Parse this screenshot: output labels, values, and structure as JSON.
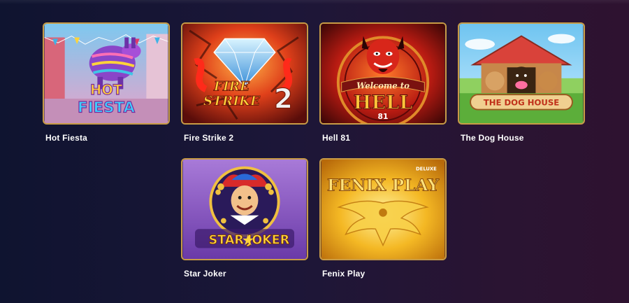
{
  "games": [
    {
      "title": "Hot Fiesta",
      "art_text": [
        "HOT",
        "FIESTA"
      ],
      "icon": "pinata-icon"
    },
    {
      "title": "Fire Strike 2",
      "art_text": [
        "FIRE",
        "STRIKE",
        "2"
      ],
      "icon": "diamond-icon"
    },
    {
      "title": "Hell 81",
      "art_text": [
        "Welcome to",
        "HELL",
        "81"
      ],
      "icon": "devil-icon"
    },
    {
      "title": "The Dog House",
      "art_text": [
        "THE DOG HOUSE"
      ],
      "icon": "dog-icon"
    },
    {
      "title": "Star Joker",
      "art_text": [
        "STAR",
        "JOKER"
      ],
      "icon": "jester-icon"
    },
    {
      "title": "Fenix Play",
      "art_text": [
        "FENIX PLAY",
        "DELUXE"
      ],
      "icon": "phoenix-icon"
    }
  ],
  "colors": {
    "card_border": "#c89b45",
    "background_left": "#0f1430",
    "background_right": "#2e1230"
  }
}
